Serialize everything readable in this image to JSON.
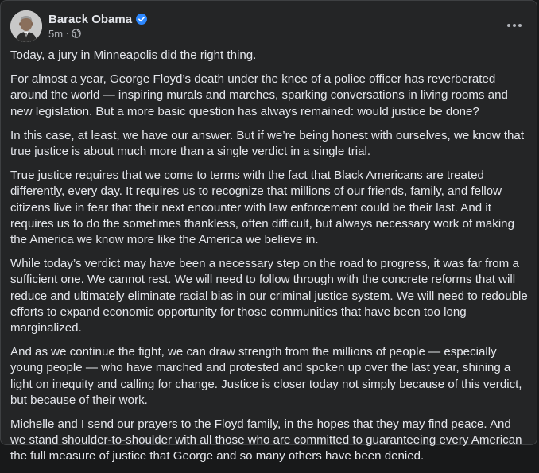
{
  "post": {
    "author": {
      "name": "Barack Obama",
      "verified": true,
      "verified_color": "#2d88ff"
    },
    "timestamp": "5m",
    "separator": "·",
    "audience_icon": "globe-icon",
    "more_icon": "more-horizontal-icon",
    "paragraphs": [
      "Today, a jury in Minneapolis did the right thing.",
      "For almost a year, George Floyd’s death under the knee of a police officer has reverberated around the world — inspiring murals and marches, sparking conversations in living rooms and new legislation. But a more basic question has always remained: would justice be done?",
      "In this case, at least, we have our answer. But if we’re being honest with ourselves, we know that true justice is about much more than a single verdict in a single trial.",
      "True justice requires that we come to terms with the fact that Black Americans are treated differently, every day. It requires us to recognize that millions of our friends, family, and fellow citizens live in fear that their next encounter with law enforcement could be their last. And it requires us to do the sometimes thankless, often difficult, but always necessary work of making the America we know more like the America we believe in.",
      "While today’s verdict may have been a necessary step on the road to progress, it was far from a sufficient one. We cannot rest. We will need to follow through with the concrete reforms that will reduce and ultimately eliminate racial bias in our criminal justice system. We will need to redouble efforts to expand economic opportunity for those communities that have been too long marginalized.",
      "And as we continue the fight, we can draw strength from the millions of people — especially young people — who have marched and protested and spoken up over the last year, shining a light on inequity and calling for change. Justice is closer today not simply because of this verdict, but because of their work.",
      "Michelle and I send our prayers to the Floyd family, in the hopes that they may find peace. And we stand shoulder-to-shoulder with all those who are committed to guaranteeing every American the full measure of justice that George and so many others have been denied."
    ]
  },
  "theme": {
    "background": "#18191a",
    "card": "#242526",
    "text_primary": "#e4e6eb",
    "text_secondary": "#b0b3b8"
  }
}
